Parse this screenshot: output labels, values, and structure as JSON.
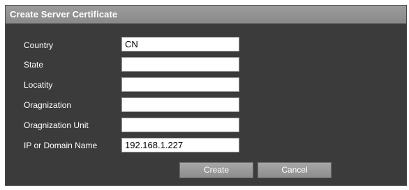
{
  "dialog": {
    "title": "Create Server Certificate"
  },
  "form": {
    "country_label": "Country",
    "country_value": "CN",
    "state_label": "State",
    "state_value": "",
    "locality_label": "Locatity",
    "locality_value": "",
    "org_label": "Oragnization",
    "org_value": "",
    "org_unit_label": "Oragnization Unit",
    "org_unit_value": "",
    "ip_domain_label": "IP or Domain Name",
    "ip_domain_value": "192.168.1.227"
  },
  "buttons": {
    "create_label": "Create",
    "cancel_label": "Cancel"
  },
  "colors": {
    "dialog_background": "#3b3b3b",
    "titlebar": "#8f8f8f",
    "button": "#9a9a9a"
  }
}
